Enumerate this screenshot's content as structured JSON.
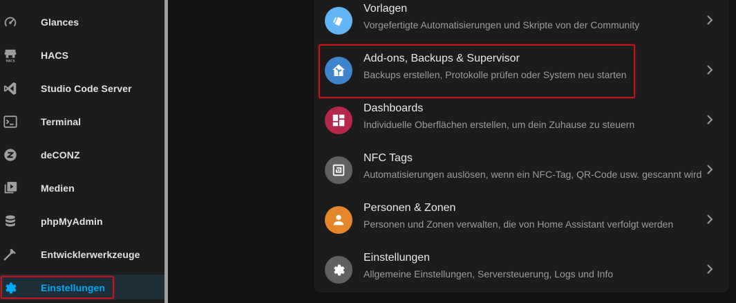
{
  "sidebar": {
    "items": [
      {
        "label": "Glances",
        "icon": "speedometer-icon",
        "active": false
      },
      {
        "label": "HACS",
        "icon": "hacs-store-icon",
        "active": false
      },
      {
        "label": "Studio Code Server",
        "icon": "vscode-icon",
        "active": false
      },
      {
        "label": "Terminal",
        "icon": "terminal-icon",
        "active": false
      },
      {
        "label": "deCONZ",
        "icon": "deconz-icon",
        "active": false
      },
      {
        "label": "Medien",
        "icon": "media-icon",
        "active": false
      },
      {
        "label": "phpMyAdmin",
        "icon": "database-icon",
        "active": false
      },
      {
        "label": "Entwicklerwerkzeuge",
        "icon": "hammer-icon",
        "active": false
      },
      {
        "label": "Einstellungen",
        "icon": "gear-icon",
        "active": true
      }
    ],
    "hacs_icon_text": "HACS"
  },
  "settings": {
    "rows": [
      {
        "title": "Vorlagen",
        "description": "Vorgefertigte Automatisierungen und Skripte von der Community",
        "icon": "blueprint-icon",
        "color": "#64b5f6"
      },
      {
        "title": "Add-ons, Backups & Supervisor",
        "description": "Backups erstellen, Protokolle prüfen oder System neu starten",
        "icon": "home-assistant-icon",
        "color": "#4084cd"
      },
      {
        "title": "Dashboards",
        "description": "Individuelle Oberflächen erstellen, um dein Zuhause zu steuern",
        "icon": "dashboard-icon",
        "color": "#b5284c"
      },
      {
        "title": "NFC Tags",
        "description": "Automatisierungen auslösen, wenn ein NFC-Tag, QR-Code usw. gescannt wird",
        "icon": "nfc-icon",
        "color": "#616161"
      },
      {
        "title": "Personen & Zonen",
        "description": "Personen und Zonen verwalten, die von Home Assistant verfolgt werden",
        "icon": "person-icon",
        "color": "#e48629"
      },
      {
        "title": "Einstellungen",
        "description": "Allgemeine Einstellungen, Serversteuerung, Logs und Info",
        "icon": "gear-icon",
        "color": "#616161"
      }
    ]
  },
  "colors": {
    "accent": "#03a9f4",
    "highlight": "#c0161c"
  }
}
